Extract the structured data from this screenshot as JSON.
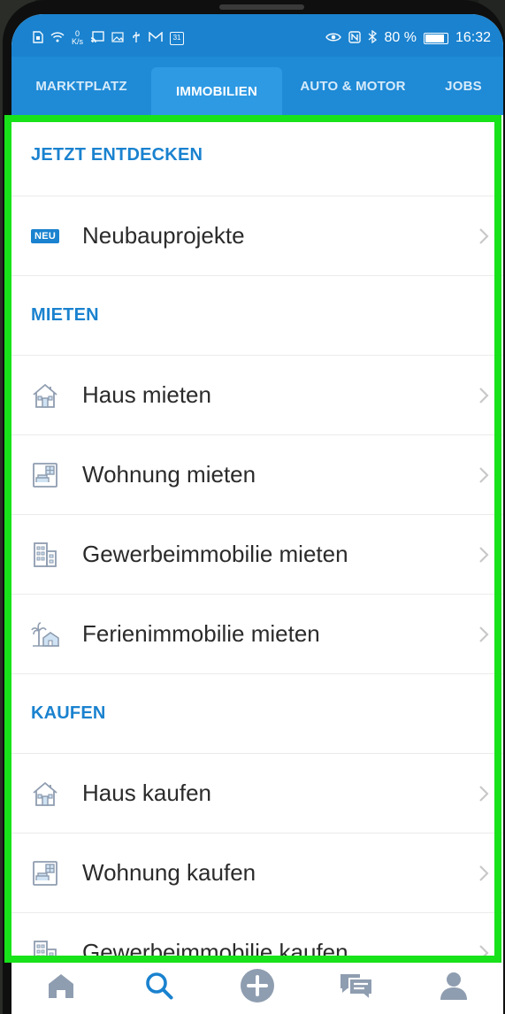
{
  "status_bar": {
    "speed_value": "0",
    "speed_unit": "K/s",
    "battery": "80 %",
    "time": "16:32",
    "calendar_day": "31",
    "battery_level": 0.8,
    "icons": [
      "sim-icon",
      "wifi-icon",
      "cast-icon",
      "image-icon",
      "usb-icon",
      "mail-icon",
      "calendar-icon",
      "eye-icon",
      "nfc-icon",
      "bluetooth-icon",
      "battery-icon"
    ]
  },
  "tabs": [
    {
      "label": "MARKTPLATZ",
      "active": false
    },
    {
      "label": "IMMOBILIEN",
      "active": true
    },
    {
      "label": "AUTO & MOTOR",
      "active": false
    },
    {
      "label": "JOBS",
      "active": false
    }
  ],
  "sections": {
    "discover": {
      "title": "JETZT ENTDECKEN",
      "items": [
        {
          "label": "Neubauprojekte",
          "badge": "NEU",
          "icon": "neu-badge-icon"
        }
      ]
    },
    "rent": {
      "title": "MIETEN",
      "items": [
        {
          "label": "Haus mieten",
          "icon": "house-icon"
        },
        {
          "label": "Wohnung mieten",
          "icon": "apartment-icon"
        },
        {
          "label": "Gewerbeimmobilie mieten",
          "icon": "commercial-building-icon"
        },
        {
          "label": "Ferienimmobilie mieten",
          "icon": "holiday-home-icon"
        }
      ]
    },
    "buy": {
      "title": "KAUFEN",
      "items": [
        {
          "label": "Haus kaufen",
          "icon": "house-icon"
        },
        {
          "label": "Wohnung kaufen",
          "icon": "apartment-icon"
        },
        {
          "label": "Gewerbeimmobilie kaufen",
          "icon": "commercial-building-icon"
        }
      ]
    }
  },
  "bottom_nav": [
    {
      "name": "home",
      "icon": "home-icon",
      "active": false
    },
    {
      "name": "search",
      "icon": "search-icon",
      "active": true
    },
    {
      "name": "add",
      "icon": "plus-circle-icon",
      "active": false
    },
    {
      "name": "messages",
      "icon": "chat-icon",
      "active": false
    },
    {
      "name": "profile",
      "icon": "user-icon",
      "active": false
    }
  ],
  "colors": {
    "primary": "#1a82cf",
    "tab_active": "#2e9ae4",
    "highlight": "#18e21a",
    "icon_muted": "#8f9db0",
    "chevron": "#c8c8c8"
  }
}
